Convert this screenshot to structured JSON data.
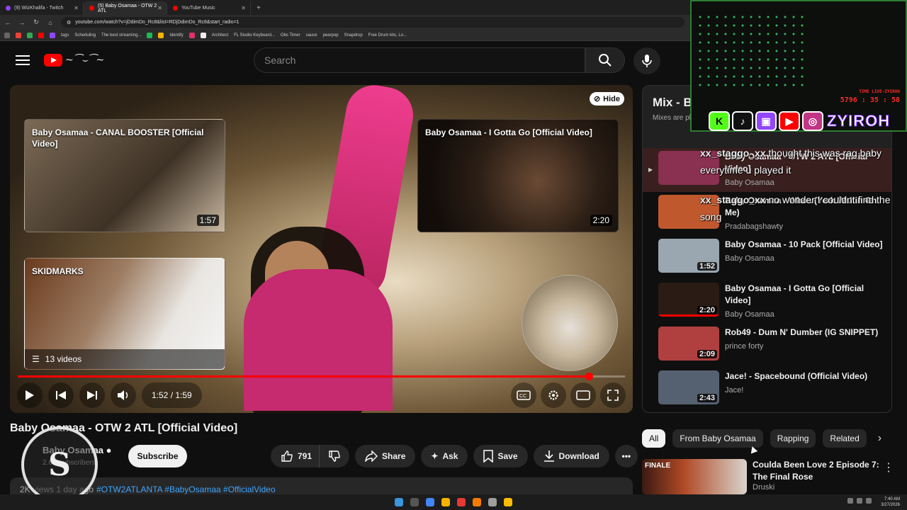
{
  "browser": {
    "tabs": [
      {
        "label": "(9) WizKhalifa - Twitch",
        "color": "#9146ff"
      },
      {
        "label": "(5) Baby Osamaa - OTW 2 ATL",
        "color": "#ff0000"
      },
      {
        "label": "YouTube Music",
        "color": "#ff0000"
      }
    ],
    "new_tab": "+",
    "url": "youtube.com/watch?v=jDdimDo_Rc8&list=RDjDdimDo_Rc8&start_radio=1",
    "bookmarks": [
      "tags",
      "Scheduling",
      "The best streaming...",
      "Identify",
      "Architect",
      "FL Studio Keyboard...",
      "Obs Timer",
      "sauce",
      "pearpop",
      "Snapdrop",
      "Free Drum kits, Lo..."
    ]
  },
  "header": {
    "search_placeholder": "Search"
  },
  "player": {
    "hide_label": "Hide",
    "time": "1:52 / 1:59",
    "progress": 0.94,
    "endcards": [
      {
        "title": "Baby Osamaa - CANAL BOOSTER [Official Video]",
        "duration": "1:57"
      },
      {
        "title": "Baby Osamaa - I Gotta Go [Official Video]",
        "duration": "2:20"
      },
      {
        "title": "SKIDMARKS",
        "count": "13 videos"
      }
    ]
  },
  "video": {
    "title": "Baby Osamaa - OTW 2 ATL [Official Video]",
    "channel": "Baby Osamaa",
    "subscribers": "2.6K subscribers",
    "subscribe_label": "Subscribe",
    "likes": "791",
    "share_label": "Share",
    "ask_label": "Ask",
    "save_label": "Save",
    "download_label": "Download",
    "description_meta": "2K views  1 day ago",
    "hashtags": "#OTW2ATLANTA #BabyOsamaa #OfficialVideo"
  },
  "playlist": {
    "title": "Mix - Baby Osamaa",
    "subtitle": "Mixes are playlists YouTube makes for you",
    "items": [
      {
        "title": "Baby Osamaa - OTW 2 ATL [Official Video]",
        "channel": "Baby Osamaa",
        "duration": "",
        "thumb": "#8a3050"
      },
      {
        "title": "Baby Osamaa - Whoa (Yerk Waitin On Me)",
        "channel": "Pradabagshawty",
        "duration": "",
        "thumb": "#c0582e"
      },
      {
        "title": "Baby Osamaa - 10 Pack [Official Video]",
        "channel": "Baby Osamaa",
        "duration": "1:52",
        "thumb": "#9aa7b0"
      },
      {
        "title": "Baby Osamaa - I Gotta Go [Official Video]",
        "channel": "Baby Osamaa",
        "duration": "2:20",
        "thumb": "#2a1c14"
      },
      {
        "title": "Rob49 - Dum N' Dumber (IG SNIPPET)",
        "channel": "prince forty",
        "duration": "2:09",
        "thumb": "#b04040"
      },
      {
        "title": "Jace! - Spacebound (Official Video)",
        "channel": "Jace!",
        "duration": "2:43",
        "thumb": "#556070"
      }
    ]
  },
  "chips": [
    "All",
    "From Baby Osamaa",
    "Rapping",
    "Related"
  ],
  "next_video": {
    "thumb_label": "FINALE",
    "title": "Coulda Been Love 2 Episode 7: The Final Rose",
    "channel": "Druski"
  },
  "overlay": {
    "handle": "ZYIROH",
    "timer_label": "TIME LIVE-ZYIROH",
    "timer": "5796 : 35 : 58",
    "chat": [
      {
        "user": "xx_staggo_xx",
        "message": "thought this was rag baby everytime u played it"
      },
      {
        "user": "xx_staggo_xx",
        "message": "no wonder I couldnt find the song"
      }
    ],
    "logo_letter": "S"
  },
  "taskbar": {
    "time": "7:40 AM",
    "date": "3/27/2026"
  }
}
